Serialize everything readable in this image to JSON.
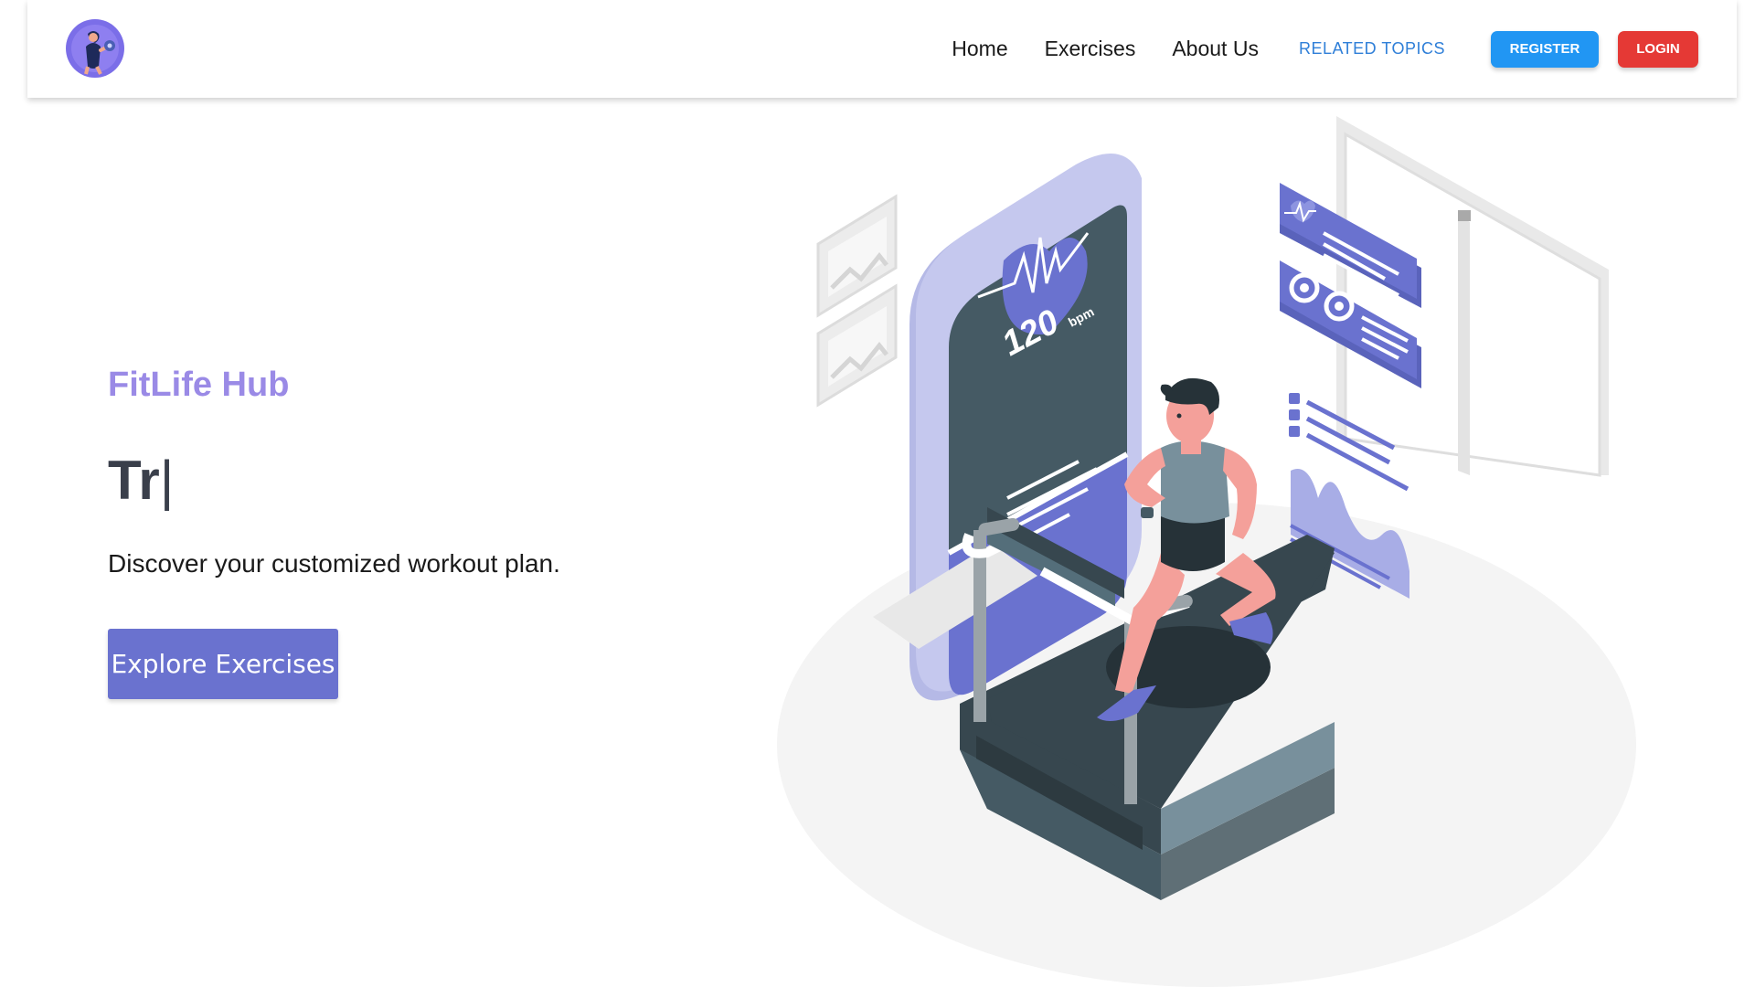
{
  "nav": {
    "logo_icon": "fitness-woman-dumbbell-icon",
    "links": [
      "Home",
      "Exercises",
      "About Us"
    ],
    "related": "RELATED TOPICS",
    "register": "REGISTER",
    "login": "LOGIN",
    "colors": {
      "register": "#2196f3",
      "login": "#e53935",
      "related": "#2f7fd8"
    }
  },
  "hero": {
    "brand": "FitLife Hub",
    "typing_text": "Tr",
    "caret": "|",
    "tagline": "Discover your customized workout plan.",
    "cta": "Explore Exercises",
    "colors": {
      "brand": "#9a8ae6",
      "cta": "#6a72cf"
    }
  },
  "illustration": {
    "subject": "man-running-on-treadmill",
    "bpm_value": "120",
    "bpm_unit": "bpm"
  }
}
